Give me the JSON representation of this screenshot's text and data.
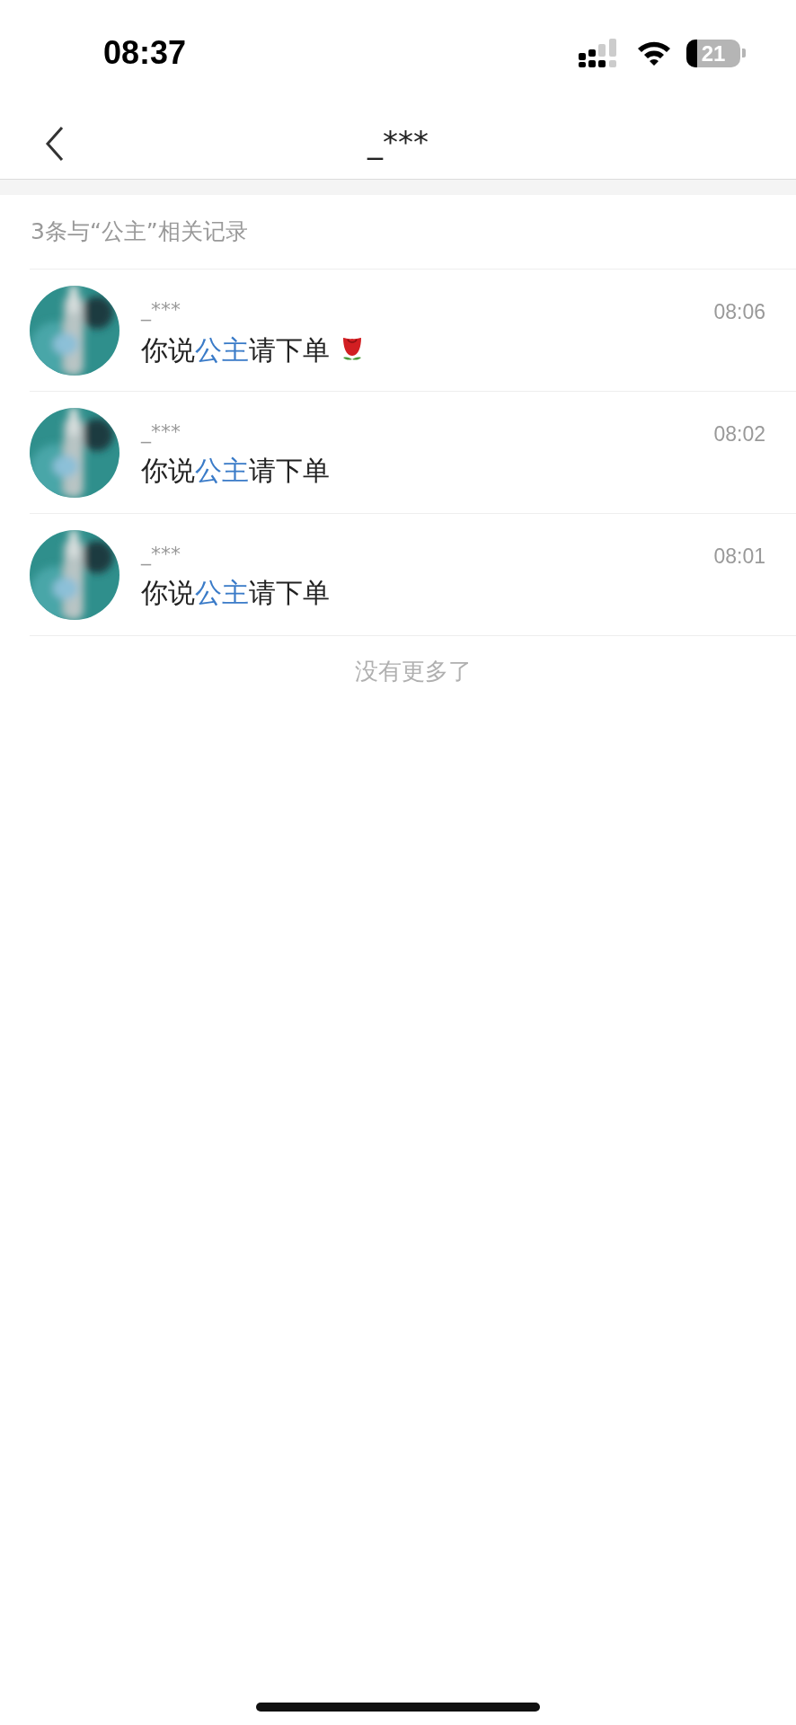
{
  "status_bar": {
    "time": "08:37",
    "battery": "21"
  },
  "header": {
    "title": "_***"
  },
  "summary": "3条与“公主”相关记录",
  "results": [
    {
      "name": "_***",
      "time": "08:06",
      "message": [
        {
          "text": "你说",
          "highlight": false
        },
        {
          "text": "公主",
          "highlight": true
        },
        {
          "text": "请下单",
          "highlight": false
        }
      ],
      "rose_emoji": true
    },
    {
      "name": "_***",
      "time": "08:02",
      "message": [
        {
          "text": "你说",
          "highlight": false
        },
        {
          "text": "公主",
          "highlight": true
        },
        {
          "text": "请下单",
          "highlight": false
        }
      ]
    },
    {
      "name": "_***",
      "time": "08:01",
      "message": [
        {
          "text": "你说",
          "highlight": false
        },
        {
          "text": "公主",
          "highlight": true
        },
        {
          "text": "请下单",
          "highlight": false
        }
      ]
    }
  ],
  "footer": "没有更多了"
}
